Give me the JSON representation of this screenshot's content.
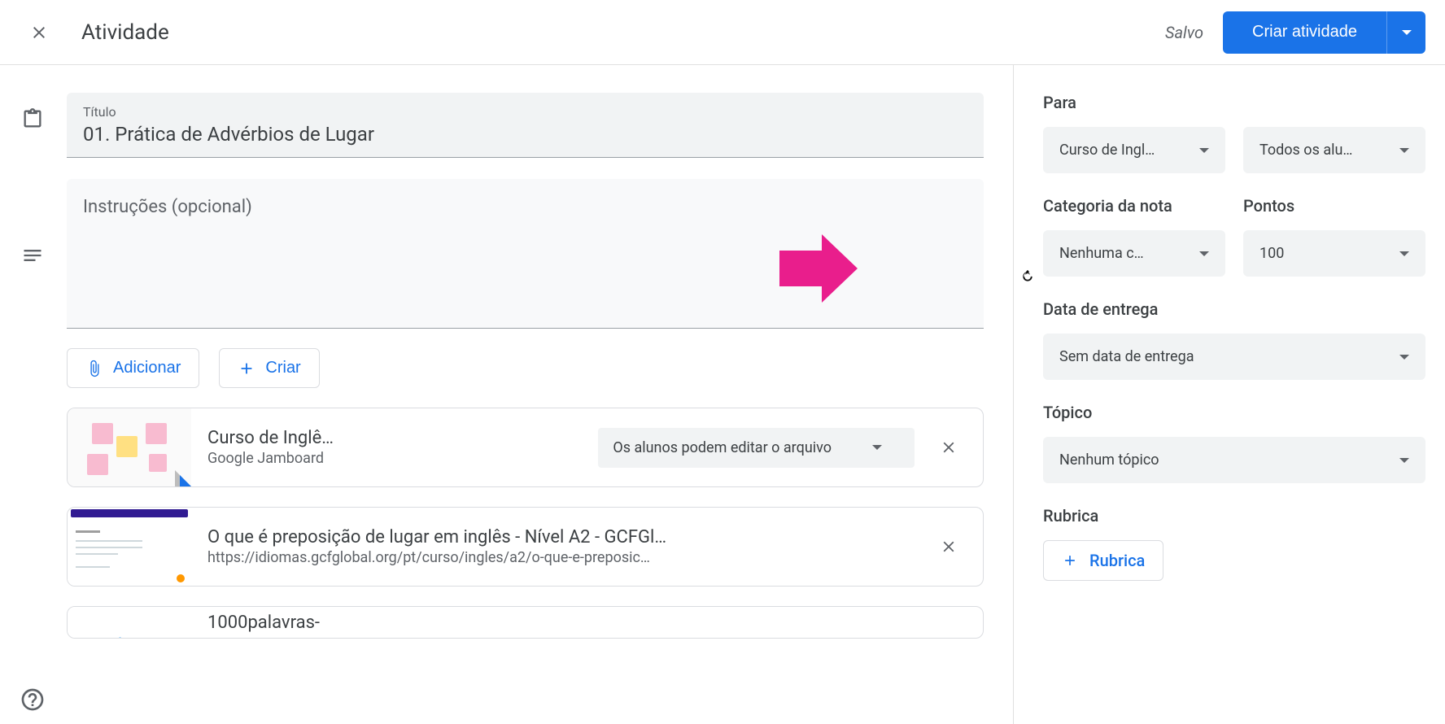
{
  "header": {
    "title": "Atividade",
    "saved": "Salvo",
    "create_button": "Criar atividade"
  },
  "form": {
    "title_label": "Título",
    "title_value": "01. Prática de Advérbios de Lugar",
    "instructions_placeholder": "Instruções (opcional)",
    "add_button": "Adicionar",
    "create_button": "Criar"
  },
  "attachments": [
    {
      "title": "Curso de Inglê…",
      "subtitle": "Google Jamboard",
      "permission": "Os alunos podem editar o arquivo"
    },
    {
      "title": "O que é preposição de lugar em inglês - Nível A2 - GCFGl…",
      "subtitle": "https://idiomas.gcfglobal.org/pt/curso/ingles/a2/o-que-e-preposic…"
    },
    {
      "title": "1000palavras-"
    }
  ],
  "sidebar": {
    "para_label": "Para",
    "class_select": "Curso de Ingl…",
    "students_select": "Todos os alu…",
    "grade_category_label": "Categoria da nota",
    "grade_category_value": "Nenhuma c…",
    "points_label": "Pontos",
    "points_value": "100",
    "due_label": "Data de entrega",
    "due_value": "Sem data de entrega",
    "topic_label": "Tópico",
    "topic_value": "Nenhum tópico",
    "rubric_label": "Rubrica",
    "rubric_button": "Rubrica"
  }
}
